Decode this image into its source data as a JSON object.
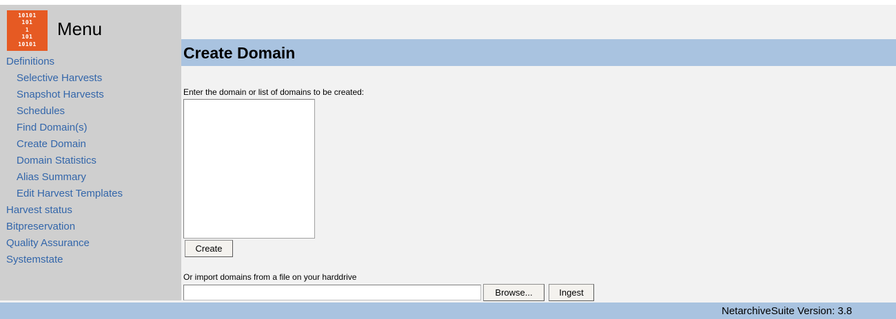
{
  "sidebar": {
    "logo_bits": "10101\n101\n1\n101\n10101",
    "logo_color": "#e65a23",
    "menu_title": "Menu",
    "items": [
      {
        "label": "Definitions",
        "level": "top"
      },
      {
        "label": "Selective Harvests",
        "level": "sub"
      },
      {
        "label": "Snapshot Harvests",
        "level": "sub"
      },
      {
        "label": "Schedules",
        "level": "sub"
      },
      {
        "label": "Find Domain(s)",
        "level": "sub"
      },
      {
        "label": "Create Domain",
        "level": "sub"
      },
      {
        "label": "Domain Statistics",
        "level": "sub"
      },
      {
        "label": "Alias Summary",
        "level": "sub"
      },
      {
        "label": "Edit Harvest Templates",
        "level": "sub"
      },
      {
        "label": "Harvest status",
        "level": "top"
      },
      {
        "label": "Bitpreservation",
        "level": "top"
      },
      {
        "label": "Quality Assurance",
        "level": "top"
      },
      {
        "label": "Systemstate",
        "level": "top"
      }
    ]
  },
  "main": {
    "title": "Create Domain",
    "instruction": "Enter the domain or list of domains to be created:",
    "domains_value": "",
    "create_label": "Create",
    "import_label": "Or import domains from a file on your harddrive",
    "file_value": "",
    "browse_label": "Browse...",
    "ingest_label": "Ingest"
  },
  "footer": {
    "version": "NetarchiveSuite Version: 3.8"
  },
  "colors": {
    "sidebar_bg": "#cfcfcf",
    "header_bar": "#a9c3e0",
    "link": "#3366aa",
    "page_bg": "#f2f2f2"
  }
}
